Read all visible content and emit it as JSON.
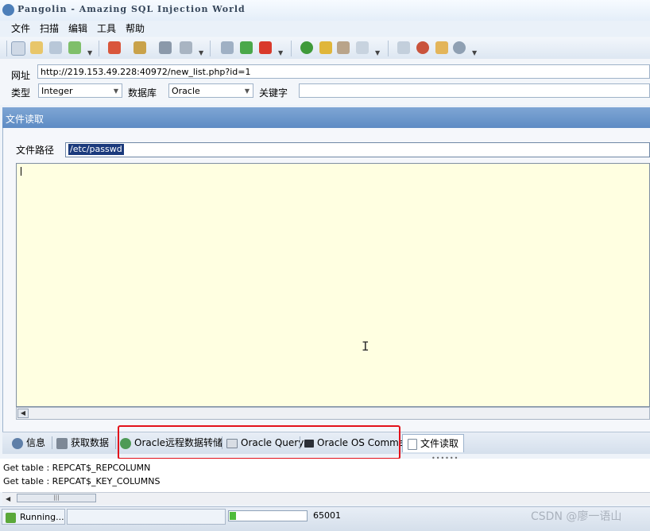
{
  "window": {
    "title": "Pangolin - Amazing SQL Injection World"
  },
  "menu": [
    "文件",
    "扫描",
    "编辑",
    "工具",
    "帮助"
  ],
  "form": {
    "url_label": "网址",
    "url_value": "http://219.153.49.228:40972/new_list.php?id=1",
    "type_label": "类型",
    "type_value": "Integer",
    "db_label": "数据库",
    "db_value": "Oracle",
    "keyword_label": "关键字",
    "keyword_value": ""
  },
  "panel": {
    "title": "文件读取",
    "path_label": "文件路径",
    "path_value": "/etc/passwd"
  },
  "tabs": [
    "信息",
    "获取数据",
    "Oracle远程数据转储",
    "Oracle Query",
    "Oracle OS Command",
    "文件读取"
  ],
  "log": [
    "Get table : REPCAT$_REPCOLUMN",
    "Get table : REPCAT$_KEY_COLUMNS"
  ],
  "status": {
    "text": "Running...",
    "progress": 0.08,
    "number": "65001"
  },
  "watermark": "CSDN @廖一语山",
  "colors": {
    "highlight": "#e2121b",
    "textarea_bg": "#ffffe1",
    "panel_header": "#6b96cb",
    "progress": "#4fbb3a"
  },
  "icons": {
    "toolbar": [
      "search-icon",
      "document-icon",
      "image-icon",
      "export-icon",
      "import-icon",
      "palette-icon",
      "wrench-icon",
      "database-icon",
      "play-icon",
      "pause-icon",
      "stop-icon",
      "check-icon",
      "key-icon",
      "users-icon",
      "magnifier-icon",
      "home-icon",
      "bug-icon",
      "plugin-icon",
      "info-icon"
    ],
    "tabs": [
      "info-icon",
      "database-icon",
      "globe-icon",
      "sql-icon",
      "terminal-icon",
      "file-icon"
    ]
  }
}
